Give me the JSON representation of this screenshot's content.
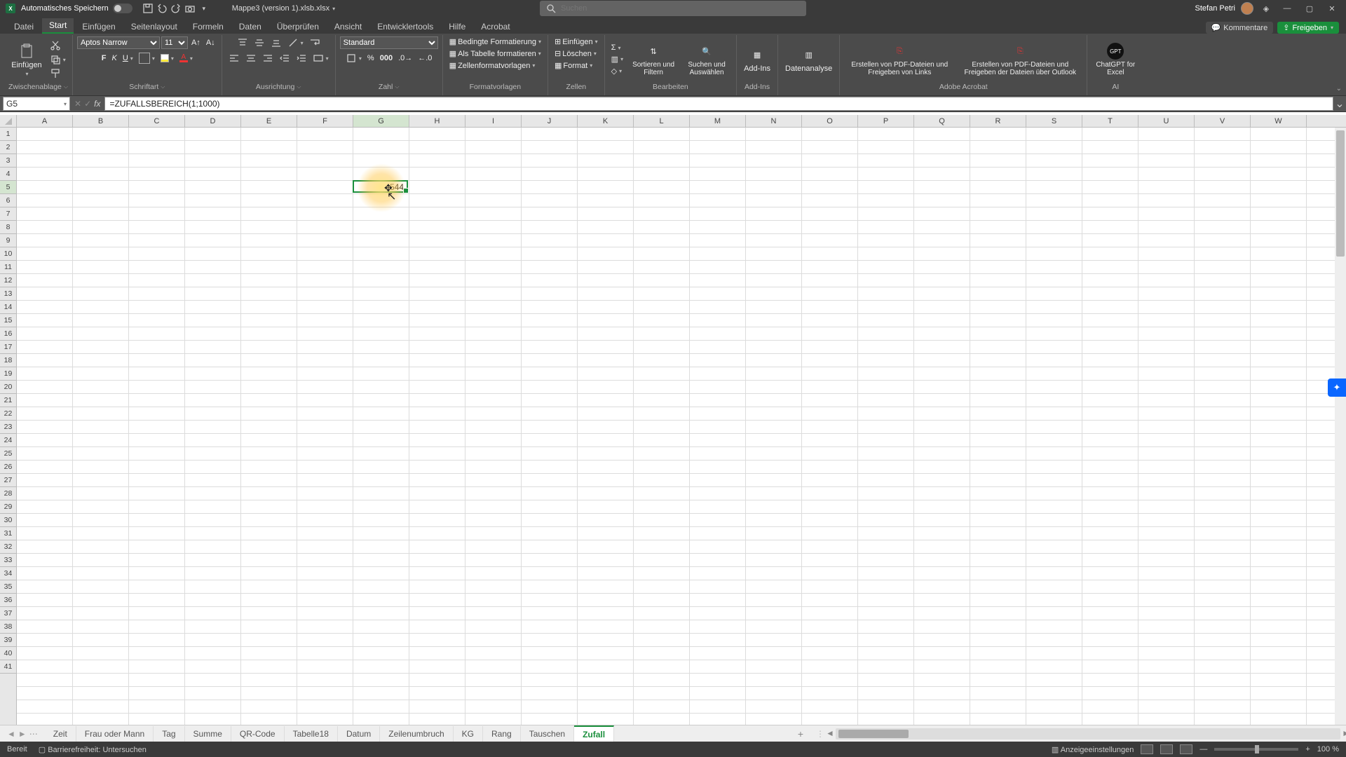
{
  "titlebar": {
    "autosave_label": "Automatisches Speichern",
    "filename": "Mappe3 (version 1).xlsb.xlsx",
    "search_placeholder": "Suchen",
    "user_name": "Stefan Petri"
  },
  "menu_tabs": [
    "Datei",
    "Start",
    "Einfügen",
    "Seitenlayout",
    "Formeln",
    "Daten",
    "Überprüfen",
    "Ansicht",
    "Entwicklertools",
    "Hilfe",
    "Acrobat"
  ],
  "menu_active_index": 1,
  "top_right": {
    "comments": "Kommentare",
    "share": "Freigeben"
  },
  "ribbon": {
    "clipboard": {
      "label": "Zwischenablage",
      "paste": "Einfügen"
    },
    "font": {
      "label": "Schriftart",
      "font_name": "Aptos Narrow",
      "font_size": "11",
      "bold": "F",
      "italic": "K",
      "underline": "U"
    },
    "align": {
      "label": "Ausrichtung"
    },
    "number": {
      "label": "Zahl",
      "format": "Standard"
    },
    "styles": {
      "label": "Formatvorlagen",
      "cond": "Bedingte Formatierung",
      "table": "Als Tabelle formatieren",
      "cell": "Zellenformatvorlagen"
    },
    "cells": {
      "label": "Zellen",
      "insert": "Einfügen",
      "delete": "Löschen",
      "format": "Format"
    },
    "editing": {
      "label": "Bearbeiten",
      "sort": "Sortieren und Filtern",
      "find": "Suchen und Auswählen"
    },
    "addins": {
      "label": "Add-Ins",
      "btn": "Add-Ins"
    },
    "analysis": {
      "btn": "Datenanalyse"
    },
    "acrobat": {
      "label": "Adobe Acrobat",
      "pdf1": "Erstellen von PDF-Dateien und Freigeben von Links",
      "pdf2": "Erstellen von PDF-Dateien und Freigeben der Dateien über Outlook"
    },
    "ai": {
      "label": "AI",
      "gpt": "ChatGPT for Excel"
    }
  },
  "namebox": "G5",
  "formula": "=ZUFALLSBEREICH(1;1000)",
  "columns": [
    "A",
    "B",
    "C",
    "D",
    "E",
    "F",
    "G",
    "H",
    "I",
    "J",
    "K",
    "L",
    "M",
    "N",
    "O",
    "P",
    "Q",
    "R",
    "S",
    "T",
    "U",
    "V",
    "W"
  ],
  "selected_col": "G",
  "row_count": 41,
  "selected_row": 5,
  "sel_cell_value": "544",
  "sheet_tabs": [
    "Zeit",
    "Frau oder Mann",
    "Tag",
    "Summe",
    "QR-Code",
    "Tabelle18",
    "Datum",
    "Zeilenumbruch",
    "KG",
    "Rang",
    "Tauschen",
    "Zufall"
  ],
  "sheet_active_index": 11,
  "statusbar": {
    "ready": "Bereit",
    "accessibility": "Barrierefreiheit: Untersuchen",
    "display_settings": "Anzeigeeinstellungen",
    "zoom": "100 %"
  }
}
